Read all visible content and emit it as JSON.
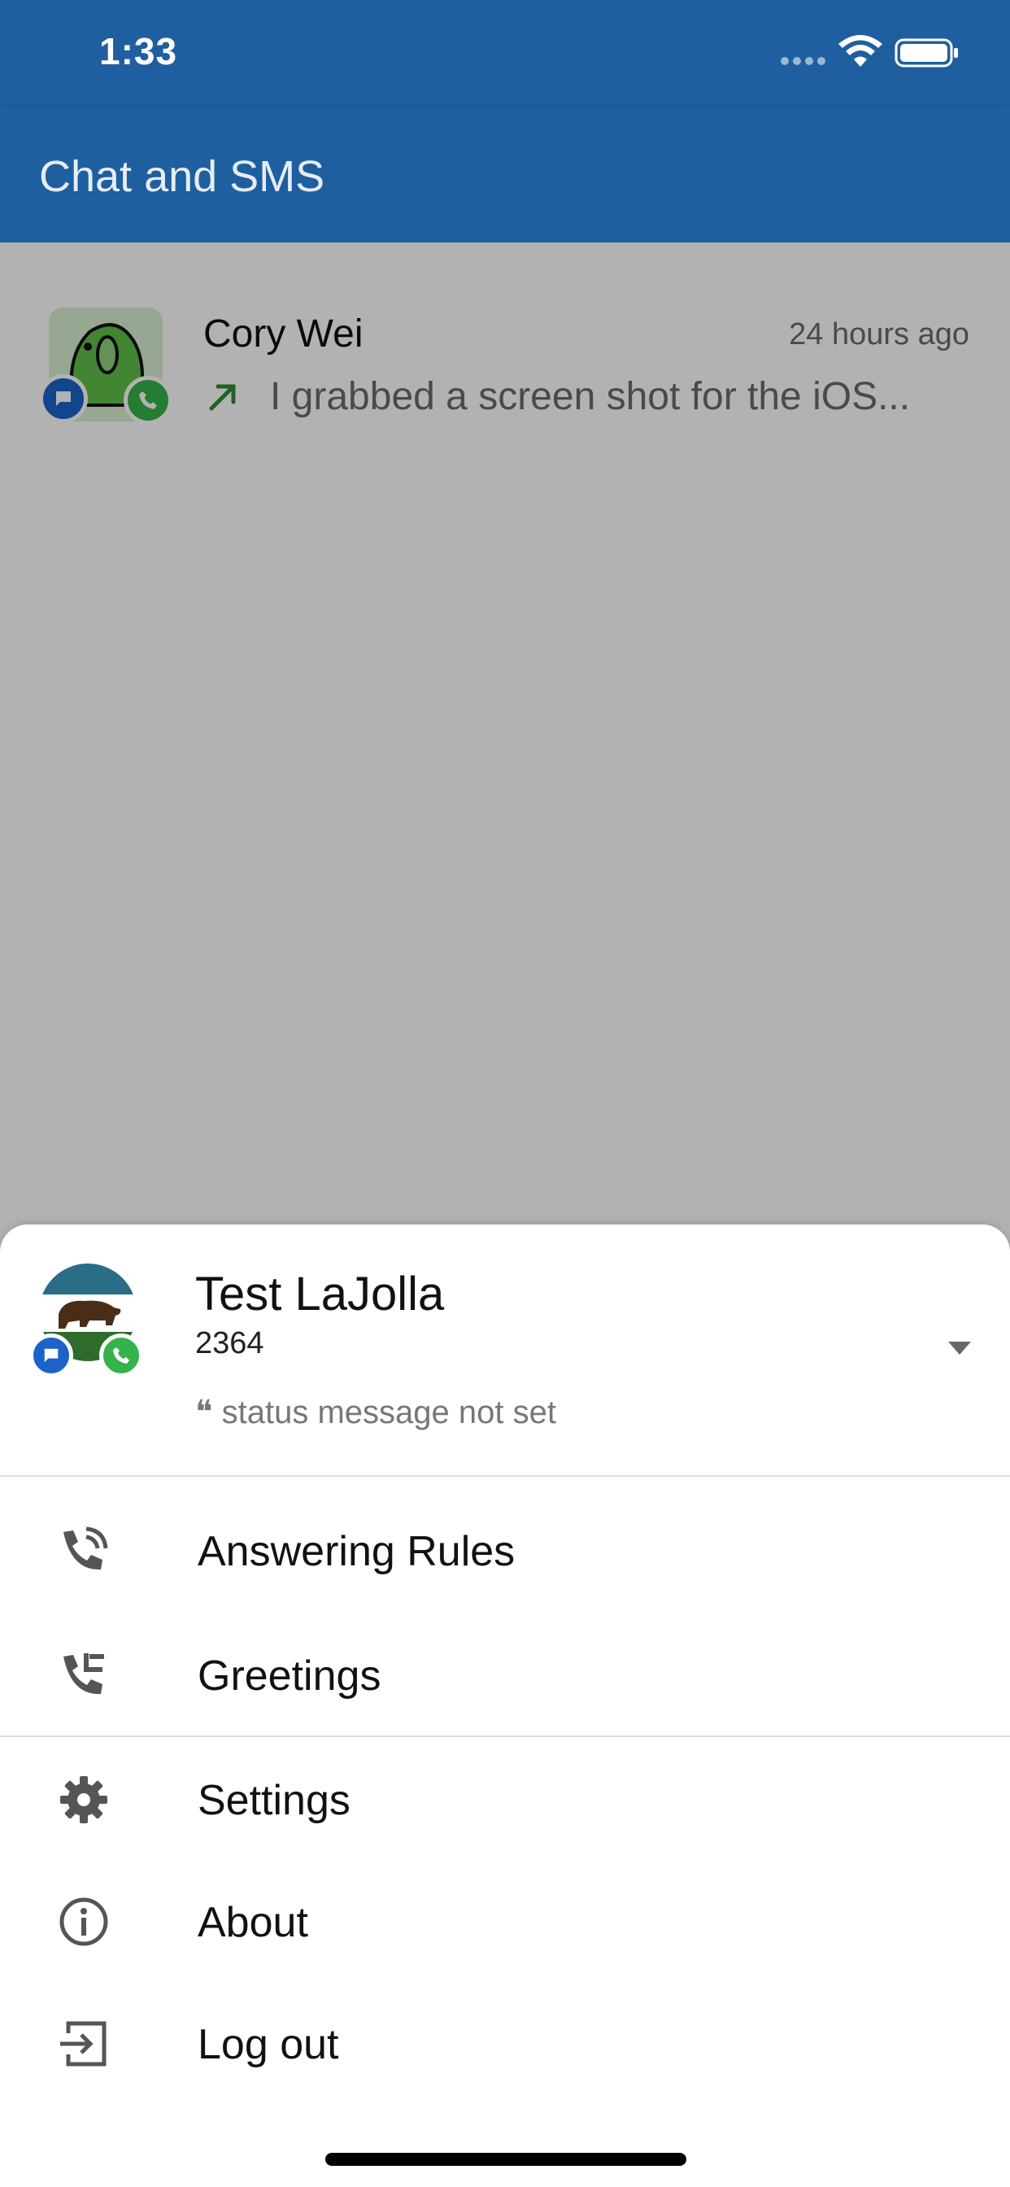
{
  "status_bar": {
    "time": "1:33"
  },
  "app_bar": {
    "title": "Chat and SMS"
  },
  "conversations": [
    {
      "name": "Cory Wei",
      "time": "24 hours ago",
      "preview": "I grabbed a screen shot for the iOS..."
    }
  ],
  "profile": {
    "name": "Test LaJolla",
    "extension": "2364",
    "status": "❝ status message not set"
  },
  "menu": {
    "answering_rules": "Answering Rules",
    "greetings": "Greetings",
    "settings": "Settings",
    "about": "About",
    "log_out": "Log out"
  },
  "colors": {
    "brand_blue": "#1d5f9f",
    "chat_badge": "#1b63c9",
    "phone_badge": "#36b24a",
    "outgoing_arrow": "#2e8b34"
  }
}
